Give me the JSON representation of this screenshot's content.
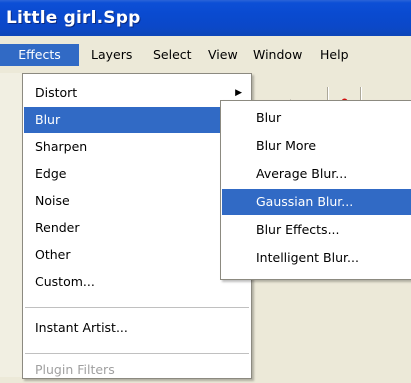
{
  "window": {
    "title": "Little girl.Spp"
  },
  "menubar": {
    "items": [
      "Effects",
      "Layers",
      "Select",
      "View",
      "Window",
      "Help"
    ]
  },
  "effects_menu": {
    "items": [
      {
        "label": "Distort",
        "submenu": true
      },
      {
        "label": "Blur",
        "submenu": true,
        "highlighted": true
      },
      {
        "label": "Sharpen",
        "submenu": true
      },
      {
        "label": "Edge",
        "submenu": true
      },
      {
        "label": "Noise",
        "submenu": true
      },
      {
        "label": "Render",
        "submenu": true
      },
      {
        "label": "Other",
        "submenu": true
      },
      {
        "label": "Custom...",
        "submenu": false
      },
      {
        "label": "Instant Artist...",
        "submenu": false
      },
      {
        "label": "Plugin Filters",
        "submenu": false,
        "disabled": true
      }
    ]
  },
  "blur_submenu": {
    "items": [
      {
        "label": "Blur"
      },
      {
        "label": "Blur More"
      },
      {
        "label": "Average Blur..."
      },
      {
        "label": "Gaussian Blur...",
        "highlighted": true
      },
      {
        "label": "Blur Effects..."
      },
      {
        "label": "Intelligent Blur..."
      }
    ]
  },
  "toolbar": {
    "icons": [
      "select-arrow-icon",
      "pen-icon",
      "pointer-icon",
      "dropdown-icon",
      "pin-icon"
    ]
  }
}
